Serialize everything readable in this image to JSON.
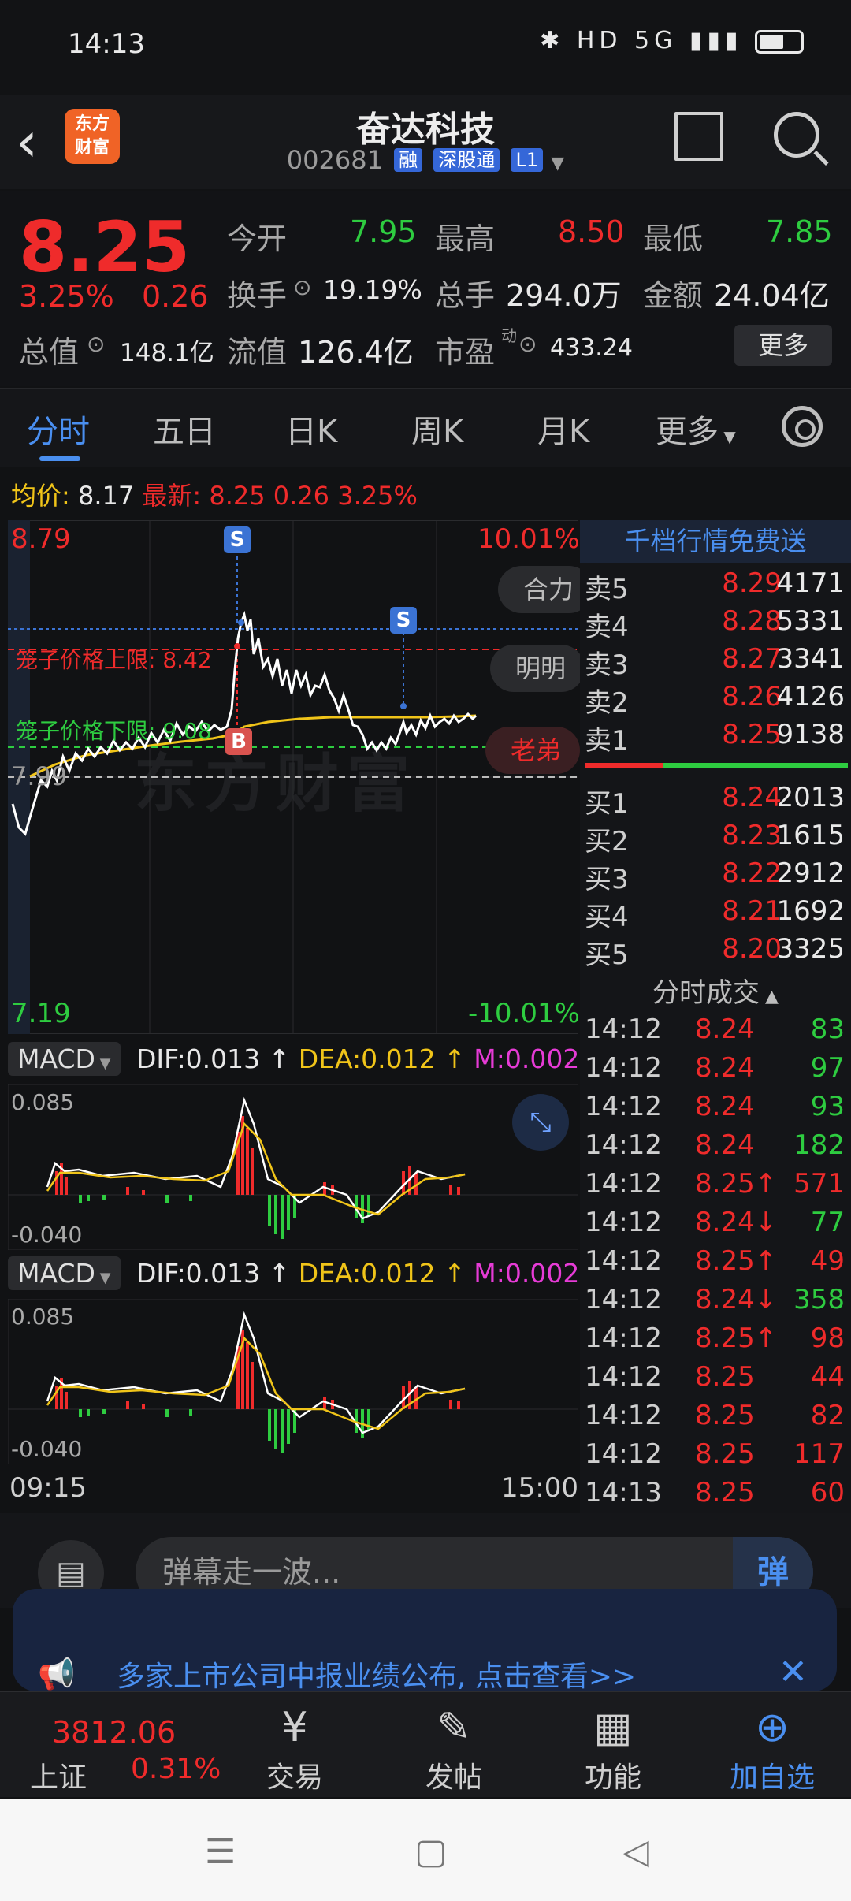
{
  "status_bar": {
    "time": "14:13",
    "icons_text": "HD 5G"
  },
  "header": {
    "app_logo_text": "东方\n财富",
    "title": "奋达科技",
    "code": "002681",
    "tags": [
      "融",
      "深股通",
      "L1"
    ]
  },
  "quote": {
    "price": "8.25",
    "change_pct": "3.25%",
    "change_val": "0.26",
    "labels": {
      "open": "今开",
      "high": "最高",
      "low": "最低",
      "turnover": "换手",
      "volume": "总手",
      "amount": "金额",
      "market_cap": "总值",
      "float_cap": "流值",
      "pe": "市盈"
    },
    "values": {
      "open": "7.95",
      "high": "8.50",
      "low": "7.85",
      "turnover": "19.19%",
      "volume": "294.0万",
      "amount": "24.04亿",
      "market_cap": "148.1亿",
      "float_cap": "126.4亿",
      "pe": "433.24"
    },
    "pe_sup": "动",
    "more_label": "更多"
  },
  "tabs": [
    "分时",
    "五日",
    "日K",
    "周K",
    "月K",
    "更多"
  ],
  "chart": {
    "avg_label": "均价:",
    "avg_value": "8.17",
    "latest_label": "最新:",
    "latest_value": "8.25",
    "latest_change": "0.26",
    "latest_pct": "3.25%",
    "y_top": "8.79",
    "y_top_pct": "10.01%",
    "y_bottom": "7.19",
    "y_bottom_pct": "-10.01%",
    "y_base": "7.99",
    "cage_upper": "笼子价格上限: 8.42",
    "cage_lower": "笼子价格下限: 9.08",
    "pills": [
      "合力",
      "明明",
      "老弟"
    ],
    "watermark": "东方财富",
    "time_start": "09:15",
    "time_end": "15:00"
  },
  "macd": [
    {
      "name": "MACD",
      "dif": "DIF:0.013",
      "dea": "DEA:0.012",
      "m": "M:0.002",
      "y_top": "0.085",
      "y_bottom": "-0.040"
    },
    {
      "name": "MACD",
      "dif": "DIF:0.013",
      "dea": "DEA:0.012",
      "m": "M:0.002",
      "y_top": "0.085",
      "y_bottom": "-0.040"
    }
  ],
  "order_book": {
    "banner": "千档行情免费送",
    "sells": [
      {
        "label": "卖5",
        "price": "8.29",
        "vol": "4171"
      },
      {
        "label": "卖4",
        "price": "8.28",
        "vol": "5331"
      },
      {
        "label": "卖3",
        "price": "8.27",
        "vol": "3341"
      },
      {
        "label": "卖2",
        "price": "8.26",
        "vol": "4126"
      },
      {
        "label": "卖1",
        "price": "8.25",
        "vol": "9138"
      }
    ],
    "buys": [
      {
        "label": "买1",
        "price": "8.24",
        "vol": "2013"
      },
      {
        "label": "买2",
        "price": "8.23",
        "vol": "1615"
      },
      {
        "label": "买3",
        "price": "8.22",
        "vol": "2912"
      },
      {
        "label": "买4",
        "price": "8.21",
        "vol": "1692"
      },
      {
        "label": "买5",
        "price": "8.20",
        "vol": "3325"
      }
    ],
    "ticks_title": "分时成交",
    "ticks": [
      {
        "time": "14:12",
        "price": "8.24",
        "vol": "83",
        "pc": "red",
        "vc": "green"
      },
      {
        "time": "14:12",
        "price": "8.24",
        "vol": "97",
        "pc": "red",
        "vc": "green"
      },
      {
        "time": "14:12",
        "price": "8.24",
        "vol": "93",
        "pc": "red",
        "vc": "green"
      },
      {
        "time": "14:12",
        "price": "8.24",
        "vol": "182",
        "pc": "red",
        "vc": "green"
      },
      {
        "time": "14:12",
        "price": "8.25↑",
        "vol": "571",
        "pc": "red",
        "vc": "red"
      },
      {
        "time": "14:12",
        "price": "8.24↓",
        "vol": "77",
        "pc": "red",
        "vc": "green"
      },
      {
        "time": "14:12",
        "price": "8.25↑",
        "vol": "49",
        "pc": "red",
        "vc": "red"
      },
      {
        "time": "14:12",
        "price": "8.24↓",
        "vol": "358",
        "pc": "red",
        "vc": "green"
      },
      {
        "time": "14:12",
        "price": "8.25↑",
        "vol": "98",
        "pc": "red",
        "vc": "red"
      },
      {
        "time": "14:12",
        "price": "8.25",
        "vol": "44",
        "pc": "red",
        "vc": "red"
      },
      {
        "time": "14:12",
        "price": "8.25",
        "vol": "82",
        "pc": "red",
        "vc": "red"
      },
      {
        "time": "14:12",
        "price": "8.25",
        "vol": "117",
        "pc": "red",
        "vc": "red"
      },
      {
        "time": "14:13",
        "price": "8.25",
        "vol": "60",
        "pc": "red",
        "vc": "red"
      }
    ]
  },
  "comment": {
    "placeholder": "弹幕走一波...",
    "danmu_btn": "弹"
  },
  "notice": {
    "text": "多家上市公司中报业绩公布, 点击查看>>"
  },
  "bottom_nav": {
    "index_value": "3812.06",
    "index_name": "上证",
    "index_pct": "0.31%",
    "items": [
      "交易",
      "发帖",
      "功能",
      "加自选"
    ]
  },
  "colors": {
    "up": "#ef2b2b",
    "down": "#2ecc40",
    "accent": "#4a8ff0",
    "avg_line": "#f0c419"
  }
}
